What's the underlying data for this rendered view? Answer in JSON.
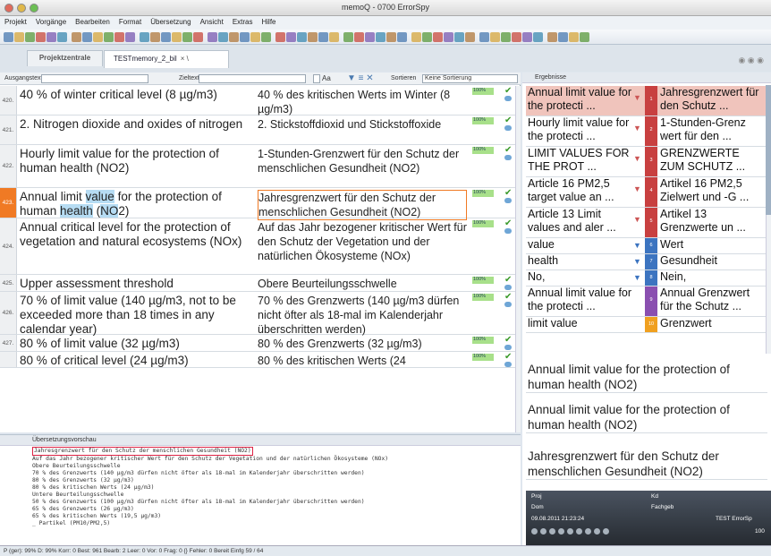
{
  "window": {
    "title": "memoQ - 0700 ErrorSpy"
  },
  "menu": [
    "Projekt",
    "Vorgänge",
    "Bearbeiten",
    "Format",
    "Übersetzung",
    "Ansicht",
    "Extras",
    "Hilfe"
  ],
  "tabs": {
    "project": "Projektzentrale",
    "document": "TESTmemory_2_bil"
  },
  "filter": {
    "source_label": "Ausgangstext",
    "target_label": "Zieltext",
    "case_label": "Aa",
    "sort_label": "Sortieren",
    "sort_value": "Keine Sortierung"
  },
  "segments": [
    {
      "num": "420.",
      "source": "40 % of winter critical level (8 µg/m3)",
      "target": "40 % des kritischen Werts im Winter (8 µg/m3)",
      "match": "100%"
    },
    {
      "num": "421.",
      "source": "2. Nitrogen dioxide and oxides of nitrogen",
      "target": "2. Stickstoffdioxid und Stickstoffoxide",
      "match": "100%"
    },
    {
      "num": "422.",
      "source": "Hourly limit value for the protection of human health (NO2)",
      "target": "1-Stunden-Grenzwert für den Schutz der menschlichen Gesundheit (NO2)",
      "match": "100%"
    },
    {
      "num": "423.",
      "source_parts": [
        "Annual limit ",
        "value",
        " for the protection of human ",
        "health",
        " (",
        "NO",
        "2)"
      ],
      "target": "Jahresgrenzwert für den Schutz der menschlichen Gesundheit (NO2)",
      "match": "100%"
    },
    {
      "num": "424.",
      "source": "Annual critical level for the protection of vegetation and natural ecosystems (NOx)",
      "target": "Auf das Jahr bezogener kritischer Wert für den Schutz der Vegetation und der natürlichen Ökosysteme (NOx)",
      "match": "100%"
    },
    {
      "num": "425.",
      "source": "Upper assessment threshold",
      "target": "Obere Beurteilungsschwelle",
      "match": "100%"
    },
    {
      "num": "426.",
      "source": "70 % of limit value (140 µg/m3, not to be exceeded more than 18 times in any calendar year)",
      "target": "70 % des Grenzwerts (140 µg/m3 dürfen nicht öfter als 18-mal im Kalenderjahr überschritten werden)",
      "match": "100%"
    },
    {
      "num": "427.",
      "source": "80 % of limit value (32 µg/m3)",
      "target": "80 % des Grenzwerts (32 µg/m3)",
      "match": "100%"
    },
    {
      "num": "",
      "source": "80 % of critical level (24 µg/m3)",
      "target": "80 % des kritischen Werts (24",
      "match": "100%"
    }
  ],
  "preview": {
    "title": "Übersetzungsvorschau",
    "lines": [
      "Jahresgrenzwert für den Schutz der menschlichen Gesundheit (NO2)",
      "Auf das Jahr bezogener kritischer Wert für den Schutz der Vegetation und der natürlichen Ökosysteme (NOx)",
      "Obere Beurteilungsschwelle",
      "70 % des Grenzwerts (140 µg/m3 dürfen nicht öfter als 18-mal im Kalenderjahr überschritten werden)",
      "80 % des Grenzwerts (32 µg/m3)",
      "80 % des kritischen Werts (24 µg/m3)",
      "Untere Beurteilungsschwelle",
      "50 % des Grenzwerts (100 µg/m3 dürfen nicht öfter als 18-mal im Kalenderjahr überschritten werden)",
      "65 % des Grenzwerts (26 µg/m3)",
      "65 % des kritischen Werts (19,5 µg/m3)",
      "_ Partikel (PM10/PM2,5)"
    ]
  },
  "results": {
    "title": "Ergebnisse",
    "items": [
      {
        "n": "1",
        "source": "Annual limit value for the protecti ...",
        "target": "Jahresgrenzwert für den Schutz ...",
        "color": "#c84040"
      },
      {
        "n": "2",
        "source": "Hourly limit value for the protecti ...",
        "target": "1-Stunden-Grenz wert für den ...",
        "color": "#c84040"
      },
      {
        "n": "3",
        "source": "LIMIT VALUES FOR THE PROT ...",
        "target": "GRENZWERTE ZUM SCHUTZ ...",
        "color": "#c84040"
      },
      {
        "n": "4",
        "source": "Article 16 PM2,5 target value an ...",
        "target": "Artikel 16 PM2,5 Zielwert und -G ...",
        "color": "#c84040"
      },
      {
        "n": "5",
        "source": "Article 13 Limit values and aler ...",
        "target": "Artikel 13 Grenzwerte un ...",
        "color": "#c84040"
      },
      {
        "n": "6",
        "source": "value",
        "target": "Wert",
        "color": "#3c74c0"
      },
      {
        "n": "7",
        "source": "health",
        "target": "Gesundheit",
        "color": "#3c74c0"
      },
      {
        "n": "8",
        "source": "No,",
        "target": "Nein,",
        "color": "#3c74c0"
      },
      {
        "n": "9",
        "source": "Annual limit value for the protecti ...",
        "target": "Annual Grenzwert für the Schutz ...",
        "color": "#8a4fb0"
      },
      {
        "n": "10",
        "source": "limit value",
        "target": "Grenzwert",
        "color": "#f0a020"
      }
    ],
    "compare1": "Annual limit value for the protection of human health (NO2)",
    "compare2": "Annual limit value for the protection of human health (NO2)",
    "compare3": "Jahresgrenzwert für den Schutz der menschlichen Gesundheit (NO2)",
    "meta": {
      "proj": "Proj",
      "dom": "Dom",
      "kd": "Kd",
      "fachgeb": "Fachgeb",
      "date": "09.08.2011 21:23:24",
      "user": "TEST ErrorSp",
      "pct": "100"
    }
  },
  "statusbar": "P (ger): 99%  D: 99%  Korr: 0  Best: 961  Bearb: 2  Leer: 0  Vor: 0  Frag: 0  {} Fehler: 0  Bereit  Einfg  59 / 64"
}
